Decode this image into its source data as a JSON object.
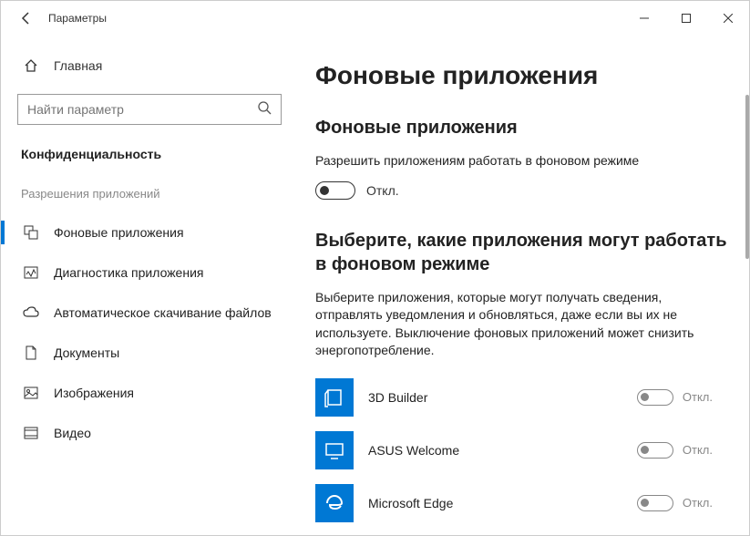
{
  "window": {
    "title": "Параметры"
  },
  "sidebar": {
    "home": "Главная",
    "search_placeholder": "Найти параметр",
    "section": "Конфиденциальность",
    "subsection": "Разрешения приложений",
    "items": [
      {
        "label": "Фоновые приложения",
        "active": true
      },
      {
        "label": "Диагностика приложения"
      },
      {
        "label": "Автоматическое скачивание файлов"
      },
      {
        "label": "Документы"
      },
      {
        "label": "Изображения"
      },
      {
        "label": "Видео"
      }
    ]
  },
  "main": {
    "title": "Фоновые приложения",
    "section1_title": "Фоновые приложения",
    "section1_desc": "Разрешить приложениям работать в фоновом режиме",
    "master_toggle_state": "Откл.",
    "section2_title": "Выберите, какие приложения могут работать в фоновом режиме",
    "section2_desc": "Выберите приложения, которые могут получать сведения, отправлять уведомления и обновляться, даже если вы их не используете. Выключение фоновых приложений может снизить энергопотребление.",
    "apps": [
      {
        "name": "3D Builder",
        "state": "Откл.",
        "color": "#0078d4"
      },
      {
        "name": "ASUS Welcome",
        "state": "Откл.",
        "color": "#0078d4"
      },
      {
        "name": "Microsoft Edge",
        "state": "Откл.",
        "color": "#0078d4"
      }
    ]
  }
}
